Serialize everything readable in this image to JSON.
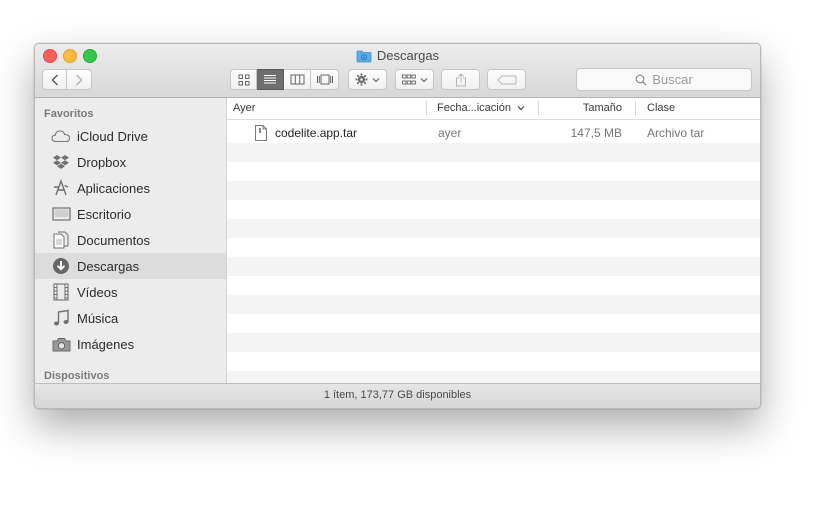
{
  "window": {
    "title": "Descargas",
    "status_text": "1 ítem, 173,77 GB disponibles"
  },
  "toolbar": {
    "search_placeholder": "Buscar",
    "view_modes": [
      "icon-view",
      "list-view",
      "column-view",
      "coverflow-view"
    ],
    "active_view": "list-view"
  },
  "sidebar": {
    "favorites_header": "Favoritos",
    "devices_header": "Dispositivos",
    "items": [
      {
        "label": "iCloud Drive",
        "icon": "cloud-icon"
      },
      {
        "label": "Dropbox",
        "icon": "dropbox-icon"
      },
      {
        "label": "Aplicaciones",
        "icon": "applications-icon"
      },
      {
        "label": "Escritorio",
        "icon": "desktop-icon"
      },
      {
        "label": "Documentos",
        "icon": "documents-icon"
      },
      {
        "label": "Descargas",
        "icon": "downloads-icon",
        "selected": true
      },
      {
        "label": "Vídeos",
        "icon": "film-icon"
      },
      {
        "label": "Música",
        "icon": "music-icon"
      },
      {
        "label": "Imágenes",
        "icon": "camera-icon"
      }
    ]
  },
  "list": {
    "columns": {
      "name": "Ayer",
      "date": "Fecha...icación",
      "size": "Tamaño",
      "kind": "Clase"
    },
    "files": [
      {
        "name": "codelite.app.tar",
        "date": "ayer",
        "size": "147,5 MB",
        "kind": "Archivo tar"
      }
    ]
  },
  "colors": {
    "close": "#fc605c",
    "minimize": "#fdbc40",
    "zoom": "#34c84a",
    "folder_blue": "#5aaee8"
  }
}
